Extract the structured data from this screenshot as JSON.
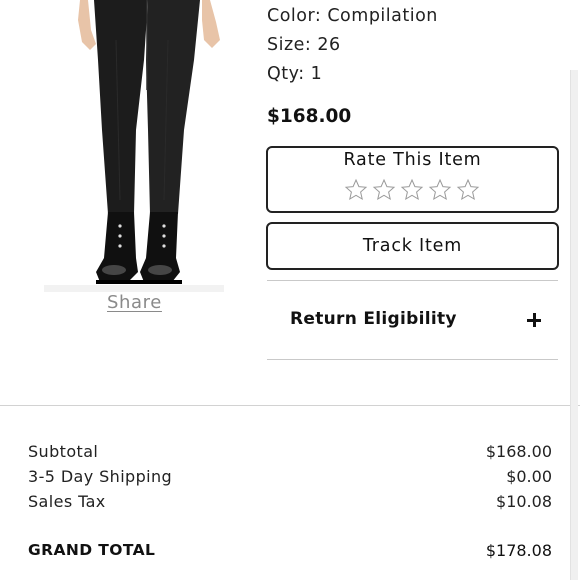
{
  "product": {
    "image_icon": "black-skinny-jeans-with-combat-boots-photo",
    "share_label": "Share",
    "color_line": "Color: Compilation",
    "size_line": "Size: 26",
    "qty_line": "Qty: 1",
    "price": "$168.00"
  },
  "rating": {
    "title": "Rate This Item",
    "star_icon": "outline-star-icon",
    "stars_max": 5,
    "stars_filled": 0
  },
  "track": {
    "label": "Track Item"
  },
  "return_eligibility": {
    "label": "Return Eligibility",
    "icon": "plus-icon"
  },
  "summary": {
    "rows": [
      {
        "label": "Subtotal",
        "value": "$168.00"
      },
      {
        "label": "3-5 Day Shipping",
        "value": "$0.00"
      },
      {
        "label": "Sales Tax",
        "value": "$10.08"
      }
    ],
    "grand_total": {
      "label": "GRAND TOTAL",
      "value": "$178.08"
    }
  }
}
